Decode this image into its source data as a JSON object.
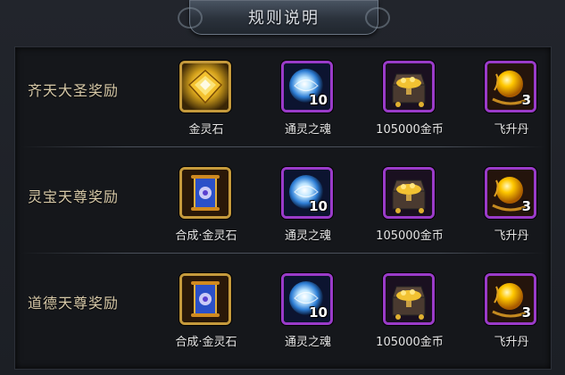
{
  "title": "规则说明",
  "rows": [
    {
      "label": "齐天大圣奖励",
      "items": [
        {
          "name": "金灵石",
          "count": "",
          "icon": "gold-spirit-stone-icon"
        },
        {
          "name": "通灵之魂",
          "count": "10",
          "icon": "spirit-soul-orb-icon"
        },
        {
          "name": "105000金币",
          "count": "",
          "icon": "treasure-chest-icon"
        },
        {
          "name": "飞升丹",
          "count": "3",
          "icon": "ascension-pill-icon"
        }
      ]
    },
    {
      "label": "灵宝天尊奖励",
      "items": [
        {
          "name": "合成·金灵石",
          "count": "",
          "icon": "synthesis-scroll-icon"
        },
        {
          "name": "通灵之魂",
          "count": "10",
          "icon": "spirit-soul-orb-icon"
        },
        {
          "name": "105000金币",
          "count": "",
          "icon": "treasure-chest-icon"
        },
        {
          "name": "飞升丹",
          "count": "3",
          "icon": "ascension-pill-icon"
        }
      ]
    },
    {
      "label": "道德天尊奖励",
      "items": [
        {
          "name": "合成·金灵石",
          "count": "",
          "icon": "synthesis-scroll-icon"
        },
        {
          "name": "通灵之魂",
          "count": "10",
          "icon": "spirit-soul-orb-icon"
        },
        {
          "name": "105000金币",
          "count": "",
          "icon": "treasure-chest-icon"
        },
        {
          "name": "飞升丹",
          "count": "3",
          "icon": "ascension-pill-icon"
        }
      ]
    }
  ],
  "colors": {
    "gold_border": "#c59a3c",
    "purple_border": "#9a3bc9",
    "label_text": "#d7c9a8"
  }
}
